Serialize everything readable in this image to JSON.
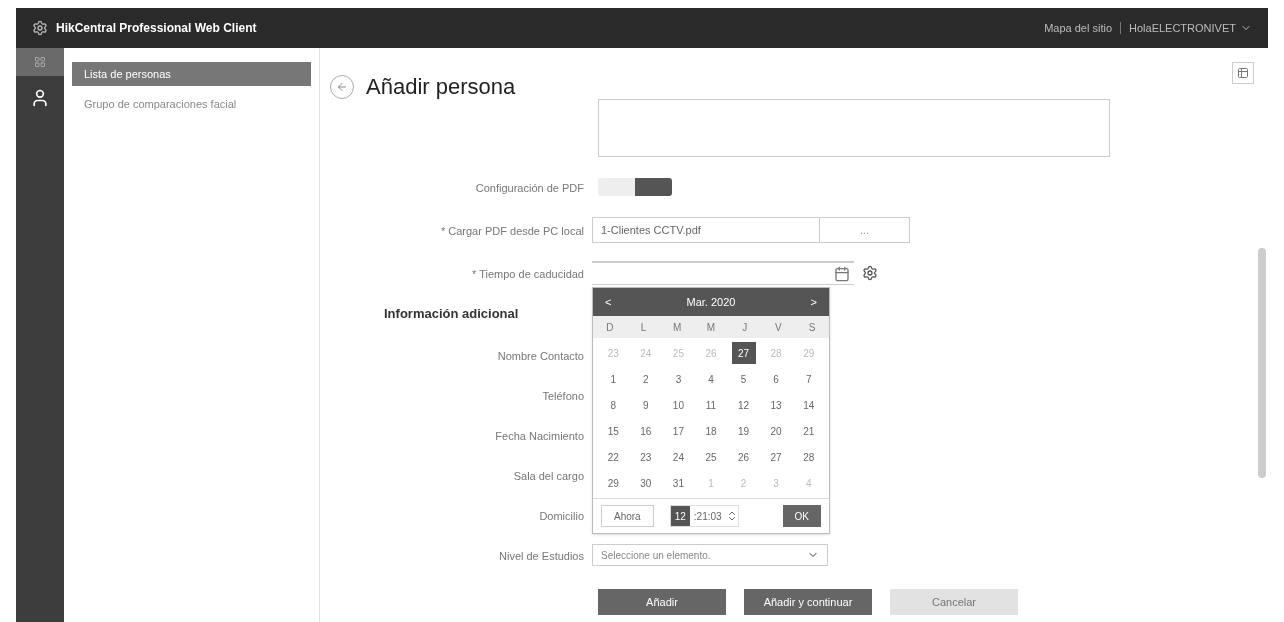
{
  "app_bar": {
    "title": "HikCentral Professional Web Client",
    "links": [
      "Mapa del sitio",
      "HolaELECTRONIVET"
    ]
  },
  "sidebar": {
    "items": [
      {
        "label": "Lista de personas",
        "selected": true
      },
      {
        "label": "Grupo de comparaciones facial",
        "selected": false
      }
    ]
  },
  "page": {
    "title": "Añadir persona"
  },
  "form": {
    "pdf_toggle": {
      "label": "Configuración de PDF",
      "on": true
    },
    "pdf_upload": {
      "label": "* Cargar PDF desde PC local",
      "value": "1-Clientes CCTV.pdf",
      "browse": "..."
    },
    "expiry": {
      "label": "* Tiempo de caducidad"
    },
    "section_title": "Información adicional",
    "fields": [
      {
        "label": "Nombre Contacto"
      },
      {
        "label": "Teléfono"
      },
      {
        "label": "Fecha Nacimiento"
      },
      {
        "label": "Sala del cargo"
      },
      {
        "label": "Domicilio"
      },
      {
        "label": "Nivel de Estudios",
        "placeholder": "Seleccione un elemento."
      }
    ]
  },
  "calendar": {
    "prev": "<",
    "month": "Mar. 2020",
    "next": ">",
    "weekdays": [
      "D",
      "L",
      "M",
      "M",
      "J",
      "V",
      "S"
    ],
    "days": [
      {
        "label": "23",
        "other_month": true,
        "selected": false
      },
      {
        "label": "24",
        "other_month": true,
        "selected": false
      },
      {
        "label": "25",
        "other_month": true,
        "selected": false
      },
      {
        "label": "26",
        "other_month": true,
        "selected": false
      },
      {
        "label": "27",
        "other_month": true,
        "selected": true
      },
      {
        "label": "28",
        "other_month": true,
        "selected": false
      },
      {
        "label": "29",
        "other_month": true,
        "selected": false
      },
      {
        "label": "1",
        "other_month": false,
        "selected": false
      },
      {
        "label": "2",
        "other_month": false,
        "selected": false
      },
      {
        "label": "3",
        "other_month": false,
        "selected": false
      },
      {
        "label": "4",
        "other_month": false,
        "selected": false
      },
      {
        "label": "5",
        "other_month": false,
        "selected": false
      },
      {
        "label": "6",
        "other_month": false,
        "selected": false
      },
      {
        "label": "7",
        "other_month": false,
        "selected": false
      },
      {
        "label": "8",
        "other_month": false,
        "selected": false
      },
      {
        "label": "9",
        "other_month": false,
        "selected": false
      },
      {
        "label": "10",
        "other_month": false,
        "selected": false
      },
      {
        "label": "11",
        "other_month": false,
        "selected": false
      },
      {
        "label": "12",
        "other_month": false,
        "selected": false
      },
      {
        "label": "13",
        "other_month": false,
        "selected": false
      },
      {
        "label": "14",
        "other_month": false,
        "selected": false
      },
      {
        "label": "15",
        "other_month": false,
        "selected": false
      },
      {
        "label": "16",
        "other_month": false,
        "selected": false
      },
      {
        "label": "17",
        "other_month": false,
        "selected": false
      },
      {
        "label": "18",
        "other_month": false,
        "selected": false
      },
      {
        "label": "19",
        "other_month": false,
        "selected": false
      },
      {
        "label": "20",
        "other_month": false,
        "selected": false
      },
      {
        "label": "21",
        "other_month": false,
        "selected": false
      },
      {
        "label": "22",
        "other_month": false,
        "selected": false
      },
      {
        "label": "23",
        "other_month": false,
        "selected": false
      },
      {
        "label": "24",
        "other_month": false,
        "selected": false
      },
      {
        "label": "25",
        "other_month": false,
        "selected": false
      },
      {
        "label": "26",
        "other_month": false,
        "selected": false
      },
      {
        "label": "27",
        "other_month": false,
        "selected": false
      },
      {
        "label": "28",
        "other_month": false,
        "selected": false
      },
      {
        "label": "29",
        "other_month": false,
        "selected": false
      },
      {
        "label": "30",
        "other_month": false,
        "selected": false
      },
      {
        "label": "31",
        "other_month": false,
        "selected": false
      },
      {
        "label": "1",
        "other_month": true,
        "selected": false
      },
      {
        "label": "2",
        "other_month": true,
        "selected": false
      },
      {
        "label": "3",
        "other_month": true,
        "selected": false
      },
      {
        "label": "4",
        "other_month": true,
        "selected": false
      }
    ],
    "now_button": "Ahora",
    "hour": "12",
    "time_rest": ":21:03",
    "ok_button": "OK"
  },
  "actions": [
    {
      "label": "Añadir",
      "kind": "primary"
    },
    {
      "label": "Añadir y continuar",
      "kind": "primary"
    },
    {
      "label": "Cancelar",
      "kind": "secondary"
    }
  ]
}
